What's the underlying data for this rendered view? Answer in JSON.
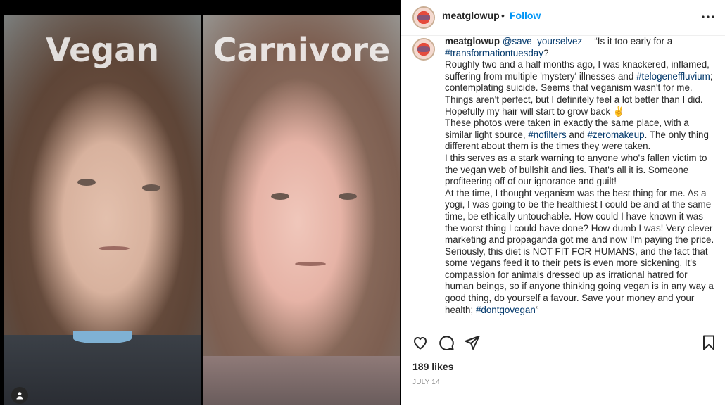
{
  "media": {
    "left_label": "Vegan",
    "right_label": "Carnivore"
  },
  "header": {
    "username": "meatglowup",
    "separator": "•",
    "follow_label": "Follow"
  },
  "caption": {
    "username": "meatglowup",
    "mention": "@save_yourselvez",
    "quote_lead": " —“Is it too early for a ",
    "hashtag_transformation": "#transformationtuesday",
    "qmark": "?",
    "p1_a": "Roughly two and a half months ago, I was knackered, inflamed, suffering from multiple 'mystery' illnesses and ",
    "hashtag_telogen": "#telogeneffluvium",
    "p1_b": "; contemplating suicide. Seems that veganism wasn't for me. Things aren't perfect, but I definitely feel a lot better than I did. Hopefully my hair will start to grow back ✌️",
    "p2_a": "These photos were taken in exactly the same place, with a similar light source, ",
    "hashtag_nofilters": "#nofilters",
    "p2_and": " and ",
    "hashtag_zeromakeup": "#zeromakeup",
    "p2_b": ". The only thing different about them is the times they were taken.",
    "p3": "I this serves as a stark warning to anyone who's fallen victim to the vegan web of bullshit and lies. That's all it is. Someone profiteering off of our ignorance and guilt!",
    "p4": "At the time, I thought veganism was the best thing for me. As a yogi, I was going to be the healthiest I could be and at the same time, be ethically untouchable. How could I have known it was the worst thing I could have done? How dumb I was! Very clever marketing and propaganda got me and now I'm paying the price. Seriously, this diet is NOT FIT FOR HUMANS, and the fact that some vegans feed it to their pets is even more sickening. It's compassion for animals dressed up as irrational hatred for human beings, so if anyone thinking going vegan is in any way a good thing, do yourself a favour. Save your money and your health; ",
    "hashtag_dontgovegan": "#dontgovegan",
    "p4_end": "”"
  },
  "footer": {
    "likes": "189 likes",
    "date": "JULY 14"
  },
  "icons": [
    "like-icon",
    "comment-icon",
    "share-icon",
    "save-icon",
    "more-icon",
    "user-tag-icon"
  ],
  "colors": {
    "link": "#00376b",
    "follow": "#0095f6",
    "muted": "#8e8e8e"
  }
}
